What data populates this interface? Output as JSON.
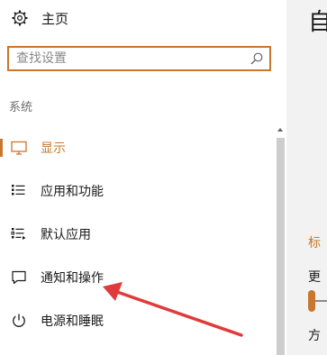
{
  "home": {
    "label": "主页",
    "icon": "gear-icon"
  },
  "search": {
    "placeholder": "查找设置",
    "icon": "search-icon"
  },
  "section_header": "系统",
  "nav_items": [
    {
      "label": "显示",
      "icon": "monitor-icon",
      "active": true
    },
    {
      "label": "应用和功能",
      "icon": "apps-list-icon",
      "active": false
    },
    {
      "label": "默认应用",
      "icon": "default-apps-icon",
      "active": false
    },
    {
      "label": "通知和操作",
      "icon": "notification-icon",
      "active": false
    },
    {
      "label": "电源和睡眠",
      "icon": "power-icon",
      "active": false
    }
  ],
  "right_pane": {
    "title": "自",
    "link": "标",
    "text1": "更",
    "text2": "方"
  },
  "colors": {
    "accent": "#c8772e",
    "annotation_arrow": "#e03b3b",
    "right_bg": "#f2f2f2"
  }
}
